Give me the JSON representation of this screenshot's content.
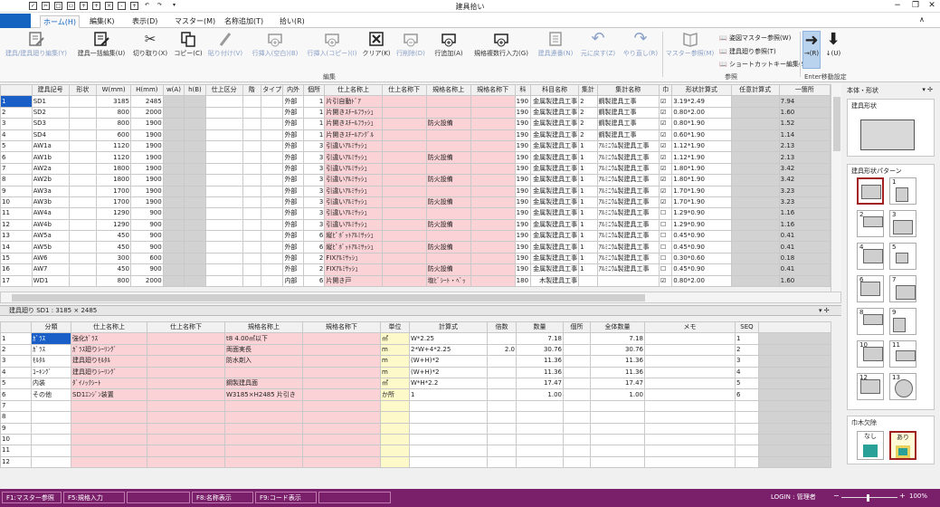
{
  "title": "建具拾い",
  "tabs": [
    "ホーム(H)",
    "編集(K)",
    "表示(D)",
    "マスター(M)",
    "名称追加(T)",
    "拾い(R)"
  ],
  "ribbon": {
    "groups": [
      "編集",
      "参照",
      "Enter移動設定"
    ],
    "buttons": [
      "建具/建具廻り編集(Y)",
      "建具一括編集(U)",
      "切り取り(X)",
      "コピー(C)",
      "貼り付け(V)",
      "行挿入(空白)(B)",
      "行挿入(コピー)(I)",
      "クリア(K)",
      "行削除(D)",
      "行追加(A)",
      "規格複数行入力(G)",
      "建具連番(N)",
      "元に戻す(Z)",
      "やり直し(R)",
      "マスター参照(M)"
    ],
    "ref_items": [
      "姿図マスター参照(W)",
      "建具廻り参照(T)",
      "ショートカットキー編集(S)"
    ],
    "enter_buttons": [
      "→(R)",
      "↓(U)"
    ]
  },
  "grid1": {
    "headers": [
      "建具記号",
      "形状",
      "W(mm)",
      "H(mm)",
      "w(A)",
      "h(B)",
      "仕上区分",
      "階",
      "タイプ",
      "内外",
      "個所",
      "仕上名称上",
      "仕上名称下",
      "規格名称上",
      "規格名称下",
      "科",
      "科目名称",
      "集計",
      "集計名称",
      "巾",
      "形状計算式",
      "任意計算式",
      "一箇所"
    ],
    "rows": [
      [
        "1",
        "SD1",
        "",
        "3185",
        "2485",
        "",
        "",
        "",
        "",
        "",
        "外部",
        "1",
        "片引自動ﾄﾞｱ",
        "",
        "",
        "",
        "190",
        "金属製建具工事",
        "2",
        "鋼製建具工事",
        "☑",
        "3.19*2.49",
        "",
        "7.94"
      ],
      [
        "2",
        "SD2",
        "",
        "800",
        "2000",
        "",
        "",
        "",
        "",
        "",
        "外部",
        "1",
        "片開きｽﾁｰﾙﾌﾗｯｼｭ",
        "",
        "",
        "",
        "190",
        "金属製建具工事",
        "2",
        "鋼製建具工事",
        "☑",
        "0.80*2.00",
        "",
        "1.60"
      ],
      [
        "3",
        "SD3",
        "",
        "800",
        "1900",
        "",
        "",
        "",
        "",
        "",
        "外部",
        "1",
        "片開きｽﾁｰﾙﾌﾗｯｼｭ",
        "",
        "防火設備",
        "",
        "190",
        "金属製建具工事",
        "2",
        "鋼製建具工事",
        "☑",
        "0.80*1.90",
        "",
        "1.52"
      ],
      [
        "4",
        "SD4",
        "",
        "600",
        "1900",
        "",
        "",
        "",
        "",
        "",
        "外部",
        "1",
        "片開きｽﾁｰﾙｱﾝｸﾞﾙ",
        "",
        "",
        "",
        "190",
        "金属製建具工事",
        "2",
        "鋼製建具工事",
        "☑",
        "0.60*1.90",
        "",
        "1.14"
      ],
      [
        "5",
        "AW1a",
        "",
        "1120",
        "1900",
        "",
        "",
        "",
        "",
        "",
        "外部",
        "3",
        "引違いｱﾙﾐｻｯｼｭ",
        "",
        "",
        "",
        "190",
        "金属製建具工事",
        "1",
        "ｱﾙﾐﾆｳﾑ製建具工事",
        "☑",
        "1.12*1.90",
        "",
        "2.13"
      ],
      [
        "6",
        "AW1b",
        "",
        "1120",
        "1900",
        "",
        "",
        "",
        "",
        "",
        "外部",
        "3",
        "引違いｱﾙﾐｻｯｼｭ",
        "",
        "防火設備",
        "",
        "190",
        "金属製建具工事",
        "1",
        "ｱﾙﾐﾆｳﾑ製建具工事",
        "☑",
        "1.12*1.90",
        "",
        "2.13"
      ],
      [
        "7",
        "AW2a",
        "",
        "1800",
        "1900",
        "",
        "",
        "",
        "",
        "",
        "外部",
        "3",
        "引違いｱﾙﾐｻｯｼｭ",
        "",
        "",
        "",
        "190",
        "金属製建具工事",
        "1",
        "ｱﾙﾐﾆｳﾑ製建具工事",
        "☑",
        "1.80*1.90",
        "",
        "3.42"
      ],
      [
        "8",
        "AW2b",
        "",
        "1800",
        "1900",
        "",
        "",
        "",
        "",
        "",
        "外部",
        "3",
        "引違いｱﾙﾐｻｯｼｭ",
        "",
        "防火設備",
        "",
        "190",
        "金属製建具工事",
        "1",
        "ｱﾙﾐﾆｳﾑ製建具工事",
        "☑",
        "1.80*1.90",
        "",
        "3.42"
      ],
      [
        "9",
        "AW3a",
        "",
        "1700",
        "1900",
        "",
        "",
        "",
        "",
        "",
        "外部",
        "3",
        "引違いｱﾙﾐｻｯｼｭ",
        "",
        "",
        "",
        "190",
        "金属製建具工事",
        "1",
        "ｱﾙﾐﾆｳﾑ製建具工事",
        "☑",
        "1.70*1.90",
        "",
        "3.23"
      ],
      [
        "10",
        "AW3b",
        "",
        "1700",
        "1900",
        "",
        "",
        "",
        "",
        "",
        "外部",
        "3",
        "引違いｱﾙﾐｻｯｼｭ",
        "",
        "防火設備",
        "",
        "190",
        "金属製建具工事",
        "1",
        "ｱﾙﾐﾆｳﾑ製建具工事",
        "☑",
        "1.70*1.90",
        "",
        "3.23"
      ],
      [
        "11",
        "AW4a",
        "",
        "1290",
        "900",
        "",
        "",
        "",
        "",
        "",
        "外部",
        "3",
        "引違いｱﾙﾐｻｯｼｭ",
        "",
        "",
        "",
        "190",
        "金属製建具工事",
        "1",
        "ｱﾙﾐﾆｳﾑ製建具工事",
        "☐",
        "1.29*0.90",
        "",
        "1.16"
      ],
      [
        "12",
        "AW4b",
        "",
        "1290",
        "900",
        "",
        "",
        "",
        "",
        "",
        "外部",
        "3",
        "引違いｱﾙﾐｻｯｼｭ",
        "",
        "防火設備",
        "",
        "190",
        "金属製建具工事",
        "1",
        "ｱﾙﾐﾆｳﾑ製建具工事",
        "☐",
        "1.29*0.90",
        "",
        "1.16"
      ],
      [
        "13",
        "AW5a",
        "",
        "450",
        "900",
        "",
        "",
        "",
        "",
        "",
        "外部",
        "6",
        "縦ﾋﾟﾎﾞｯﾄｱﾙﾐｻｯｼｭ",
        "",
        "",
        "",
        "190",
        "金属製建具工事",
        "1",
        "ｱﾙﾐﾆｳﾑ製建具工事",
        "☐",
        "0.45*0.90",
        "",
        "0.41"
      ],
      [
        "14",
        "AW5b",
        "",
        "450",
        "900",
        "",
        "",
        "",
        "",
        "",
        "外部",
        "6",
        "縦ﾋﾟﾎﾞｯﾄｱﾙﾐｻｯｼｭ",
        "",
        "防火設備",
        "",
        "190",
        "金属製建具工事",
        "1",
        "ｱﾙﾐﾆｳﾑ製建具工事",
        "☐",
        "0.45*0.90",
        "",
        "0.41"
      ],
      [
        "15",
        "AW6",
        "",
        "300",
        "600",
        "",
        "",
        "",
        "",
        "",
        "外部",
        "2",
        "FIXｱﾙﾐｻｯｼｭ",
        "",
        "",
        "",
        "190",
        "金属製建具工事",
        "1",
        "ｱﾙﾐﾆｳﾑ製建具工事",
        "☐",
        "0.30*0.60",
        "",
        "0.18"
      ],
      [
        "16",
        "AW7",
        "",
        "450",
        "900",
        "",
        "",
        "",
        "",
        "",
        "外部",
        "2",
        "FIXｱﾙﾐｻｯｼｭ",
        "",
        "防火設備",
        "",
        "190",
        "金属製建具工事",
        "1",
        "ｱﾙﾐﾆｳﾑ製建具工事",
        "☐",
        "0.45*0.90",
        "",
        "0.41"
      ],
      [
        "17",
        "WD1",
        "",
        "800",
        "2000",
        "",
        "",
        "",
        "",
        "",
        "内部",
        "6",
        "片開き戸",
        "",
        "塩ﾋﾞｼｰﾄ・ﾍﾞｯ",
        "",
        "180",
        "木製建具工事",
        "",
        "",
        "☑",
        "0.80*2.00",
        "",
        "1.60"
      ]
    ]
  },
  "detail_label": "建具廻り SD1 : 3185 × 2485",
  "grid2": {
    "headers": [
      "分類",
      "仕上名称上",
      "仕上名称下",
      "規格名称上",
      "規格名称下",
      "単位",
      "計算式",
      "倍数",
      "数量",
      "個所",
      "全体数量",
      "メモ",
      "SEQ"
    ],
    "rows": [
      [
        "1",
        "ｶﾞﾗｽ",
        "強化ｶﾞﾗｽ",
        "",
        "t8 4.00㎡以下",
        "",
        "㎡",
        "W*2.25",
        "",
        "7.18",
        "",
        "7.18",
        "",
        "1"
      ],
      [
        "2",
        "ｶﾞﾗｽ",
        "ｶﾞﾗｽ廻りｼｰﾘﾝｸﾞ",
        "",
        "両面実長",
        "",
        "m",
        "2*W+4*2.25",
        "2.0",
        "30.76",
        "",
        "30.76",
        "",
        "2"
      ],
      [
        "3",
        "ﾓﾙﾀﾙ",
        "建具廻りﾓﾙﾀﾙ",
        "",
        "防水剤入",
        "",
        "m",
        "(W+H)*2",
        "",
        "11.36",
        "",
        "11.36",
        "",
        "3"
      ],
      [
        "4",
        "ｺｰｷﾝｸﾞ",
        "建具廻りｼｰﾘﾝｸﾞ",
        "",
        "",
        "",
        "m",
        "(W+H)*2",
        "",
        "11.36",
        "",
        "11.36",
        "",
        "4"
      ],
      [
        "5",
        "内装",
        "ﾀﾞｲﾉｯｸｼｰﾄ",
        "",
        "鋼製建具面",
        "",
        "㎡",
        "W*H*2.2",
        "",
        "17.47",
        "",
        "17.47",
        "",
        "5"
      ],
      [
        "6",
        "その他",
        "SD1ｴﾝｼﾞﾝ装置",
        "",
        "W3185×H2485 片引き",
        "",
        "か所",
        "1",
        "",
        "1.00",
        "",
        "1.00",
        "",
        "6"
      ],
      [
        "7",
        "",
        "",
        "",
        "",
        "",
        "",
        "",
        "",
        "",
        "",
        "",
        "",
        ""
      ],
      [
        "8",
        "",
        "",
        "",
        "",
        "",
        "",
        "",
        "",
        "",
        "",
        "",
        "",
        ""
      ],
      [
        "9",
        "",
        "",
        "",
        "",
        "",
        "",
        "",
        "",
        "",
        "",
        "",
        "",
        ""
      ],
      [
        "10",
        "",
        "",
        "",
        "",
        "",
        "",
        "",
        "",
        "",
        "",
        "",
        "",
        ""
      ],
      [
        "11",
        "",
        "",
        "",
        "",
        "",
        "",
        "",
        "",
        "",
        "",
        "",
        "",
        ""
      ],
      [
        "12",
        "",
        "",
        "",
        "",
        "",
        "",
        "",
        "",
        "",
        "",
        "",
        "",
        ""
      ]
    ]
  },
  "side": {
    "tab": "本体・形状",
    "shape_title": "建具形状",
    "pattern_title": "建具形状パターン",
    "patterns": [
      "",
      "1",
      "2",
      "3",
      "4",
      "5",
      "6",
      "7",
      "8",
      "9",
      "10",
      "11",
      "12",
      "13"
    ],
    "habaki_title": "巾木欠除",
    "habaki": [
      "なし",
      "あり"
    ]
  },
  "status": {
    "keys": [
      "F1:マスター参照",
      "F5:規格入力",
      "F8:名称表示",
      "F9:コード表示"
    ],
    "login": "LOGIN : 管理者",
    "zoom": "100%"
  }
}
